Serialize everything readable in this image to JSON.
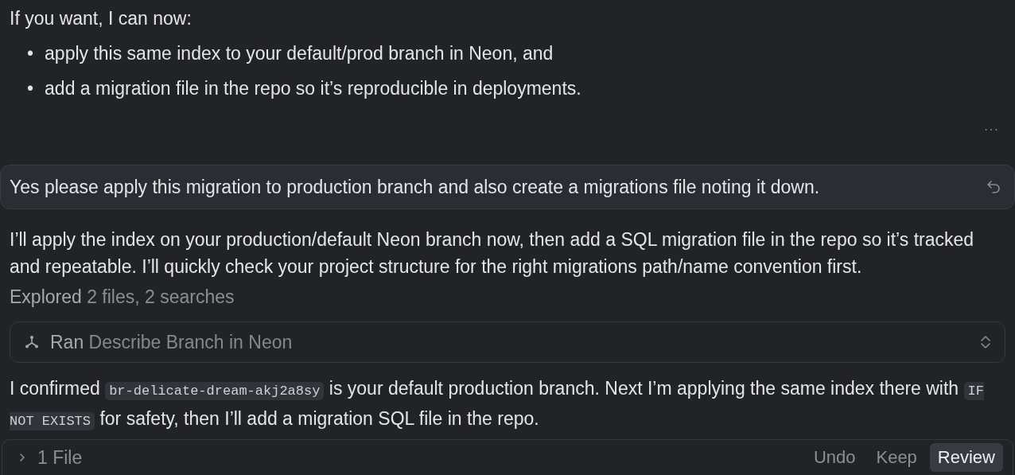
{
  "intro": "If you want, I can now:",
  "bullets": [
    {
      "marker": "•",
      "text": "apply this same index to your default/prod branch in Neon, and"
    },
    {
      "marker": "•",
      "text": "add a migration file in the repo so it’s reproducible in deployments."
    }
  ],
  "more_menu": "···",
  "user_message": {
    "text": "Yes please apply this migration to production branch and also create a migrations file noting it down."
  },
  "reply": "I’ll apply the index on your production/default Neon branch now, then add a SQL migration file in the repo so it’s tracked and repeatable. I’ll quickly check your project structure for the right migrations path/name convention first.",
  "explored": {
    "label": "Explored",
    "detail": "2 files, 2 searches"
  },
  "tool_call": {
    "label": "Ran",
    "detail": "Describe Branch in Neon",
    "expanded": false
  },
  "confirmation": [
    {
      "kind": "text",
      "text": "I confirmed "
    },
    {
      "kind": "code",
      "text": "br-delicate-dream-akj2a8sy"
    },
    {
      "kind": "text",
      "text": " is your default production branch. Next I’m applying the same index there with "
    },
    {
      "kind": "code",
      "text": "IF NOT EXISTS"
    },
    {
      "kind": "text",
      "text": " for safety, then I’ll add a migration SQL file in the repo."
    }
  ],
  "bottom_bar": {
    "files": "1 File",
    "buttons": [
      {
        "label": "Undo",
        "selected": false
      },
      {
        "label": "Keep",
        "selected": false
      },
      {
        "label": "Review",
        "selected": true
      }
    ]
  }
}
